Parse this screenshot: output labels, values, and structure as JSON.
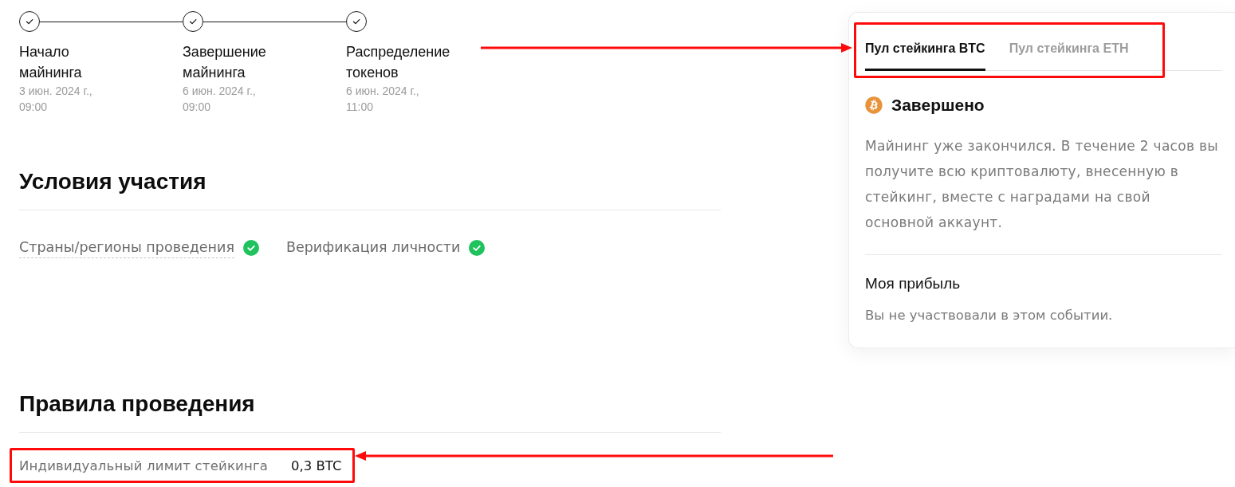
{
  "timeline": [
    {
      "title": "Начало майнинга",
      "date": "3 июн. 2024 г., 09:00",
      "done": true
    },
    {
      "title": "Завершение майнинга",
      "date": "6 июн. 2024 г., 09:00",
      "done": true
    },
    {
      "title": "Распределение токенов",
      "date": "6 июн. 2024 г., 11:00",
      "done": true
    }
  ],
  "conditions": {
    "title": "Условия участия",
    "items": [
      {
        "label": "Страны/регионы проведения",
        "dashed_underline": true,
        "met": true
      },
      {
        "label": "Верификация личности",
        "dashed_underline": false,
        "met": true
      }
    ]
  },
  "rules": {
    "title": "Правила проведения",
    "rows": [
      {
        "label": "Индивидуальный лимит стейкинга",
        "value": "0,3 BTC",
        "highlighted": true
      }
    ]
  },
  "pool_card": {
    "tabs": [
      {
        "label": "Пул стейкинга BTC",
        "selected": true
      },
      {
        "label": "Пул стейкинга ETH",
        "selected": false
      }
    ],
    "tabs_highlighted": true,
    "status": "Завершено",
    "description": "Майнинг уже закончился. В течение 2 часов вы получите всю криптовалюту, внесенную в стейкинг, вместе с наградами на свой основной аккаунт.",
    "profit": {
      "title": "Моя прибыль",
      "text": "Вы не участвовали в этом событии."
    }
  }
}
